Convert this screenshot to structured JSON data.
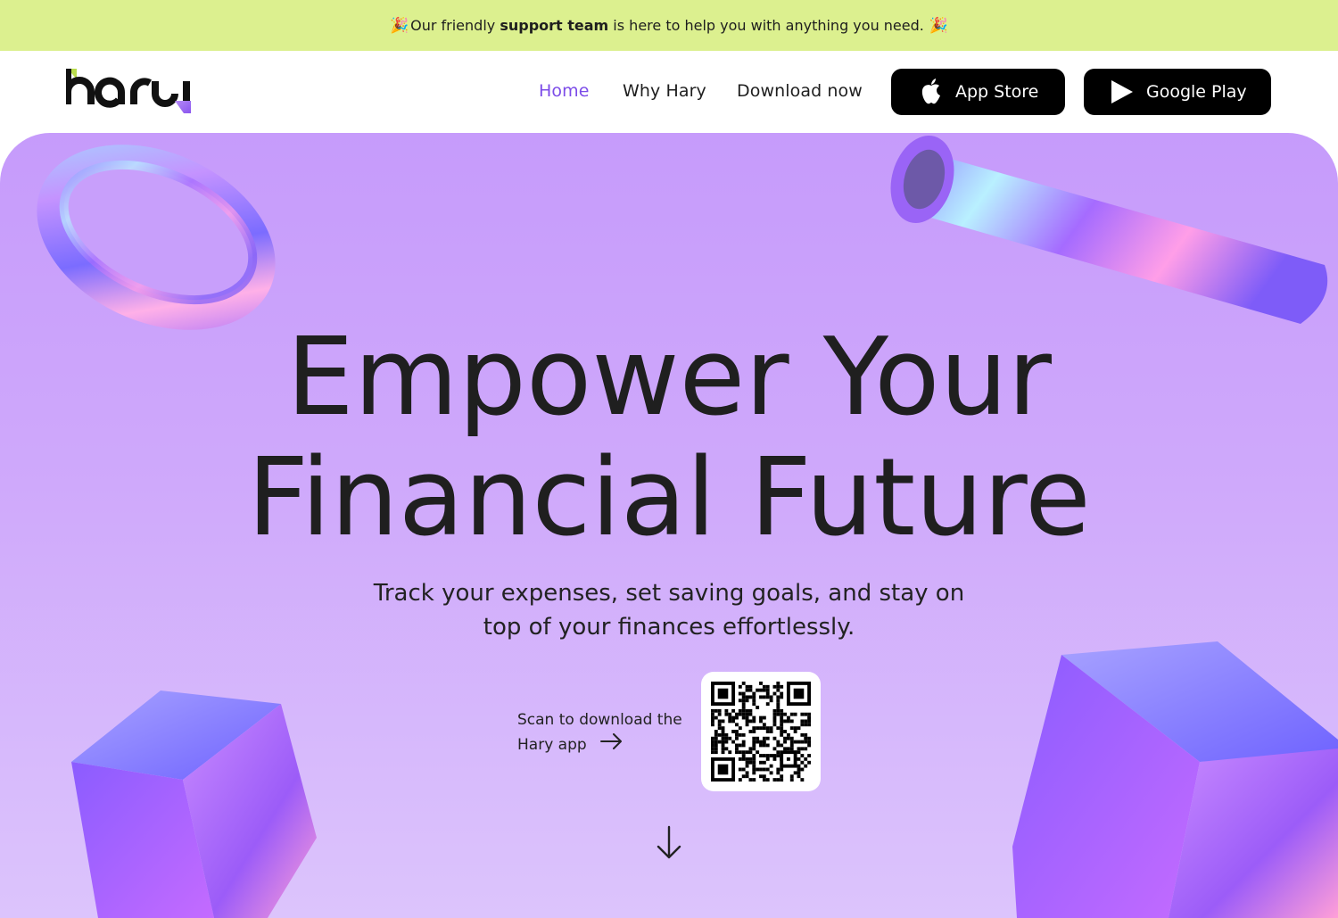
{
  "banner": {
    "emoji_left": "🎉",
    "text_before": "Our friendly ",
    "text_bold": "support team",
    "text_after": " is here to help you with anything you need.",
    "emoji_right": "🎉"
  },
  "nav": {
    "logo_text": "hary",
    "links": [
      {
        "label": "Home",
        "active": true
      },
      {
        "label": "Why Hary",
        "active": false
      },
      {
        "label": "Download now",
        "active": false
      }
    ],
    "app_store_label": "App Store",
    "google_play_label": "Google Play"
  },
  "hero": {
    "title_line1": "Empower Your",
    "title_line2": "Financial Future",
    "subtitle": "Track your expenses, set saving goals, and stay on top of your finances effortlessly.",
    "scan_text": "Scan to download the Hary app"
  },
  "colors": {
    "banner_bg": "#dcf08f",
    "accent": "#7c4ce8",
    "hero_top": "#c69bfb",
    "hero_bottom": "#dcc4fc",
    "button_bg": "#000000"
  },
  "icons": [
    "apple-icon",
    "google-play-icon",
    "arrow-right-icon",
    "arrow-down-icon",
    "qr-code"
  ]
}
